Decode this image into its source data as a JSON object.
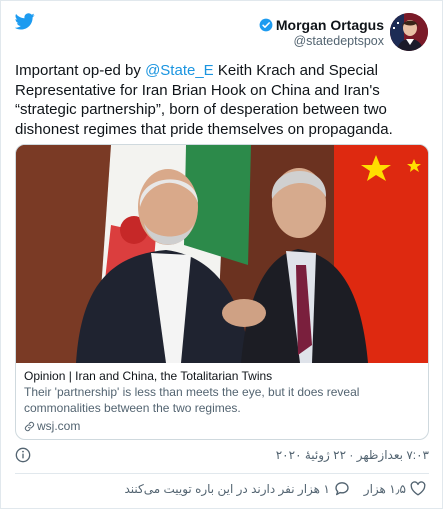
{
  "author": {
    "name": "Morgan Ortagus",
    "handle": "@statedeptspox"
  },
  "tweet": {
    "line1_a": "Important op-ed by ",
    "mention": "@State_E",
    "line1_b": " Keith Krach and Special Representative for Iran Brian Hook on China and Iran's “strategic partnership”, born of desperation between two dishonest regimes that pride themselves on propaganda."
  },
  "link_card": {
    "title": "Opinion | Iran and China, the Totalitarian Twins",
    "description": "Their 'partnership' is less than meets the eye, but it does reveal commonalities between the two regimes.",
    "domain": "wsj.com"
  },
  "meta": {
    "timestamp": "۷:۰۳ بعدازظهر · ۲۲ ژوئیهٔ ۲۰۲۰"
  },
  "actions": {
    "likes": "۱٫۵ هزار",
    "replies": "۱ هزار نفر دارند در این باره توییت می‌کنند"
  },
  "colors": {
    "accent": "#1b95e0",
    "verified": "#1d9bf0"
  }
}
